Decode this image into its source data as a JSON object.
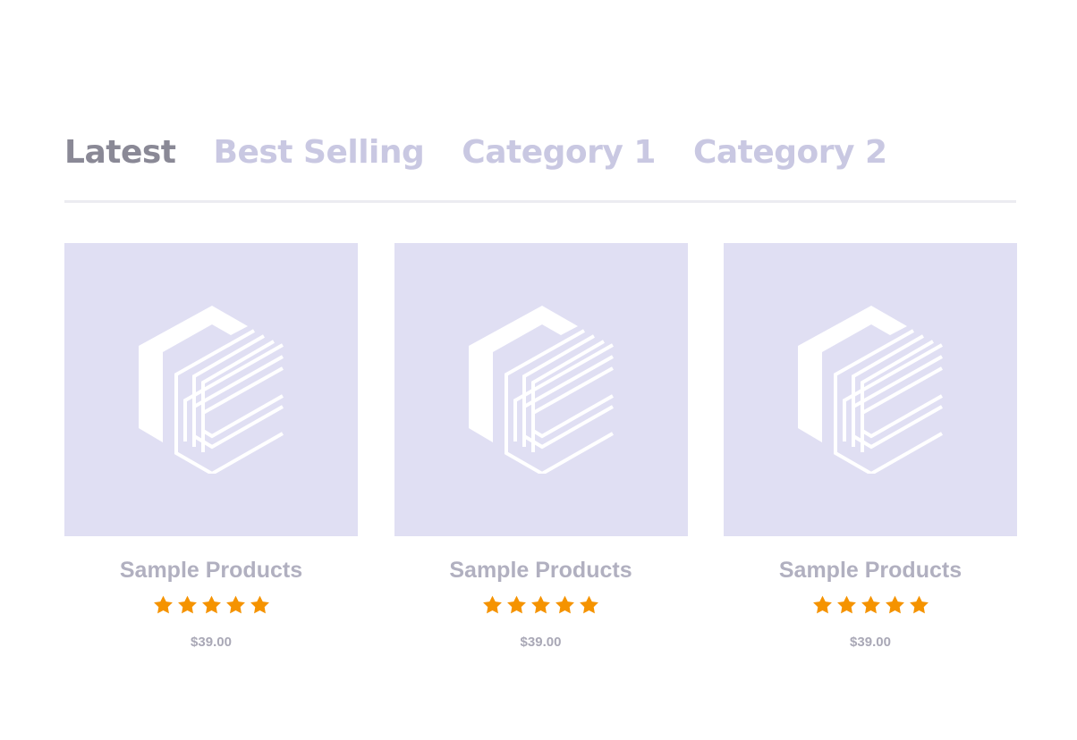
{
  "tabs": [
    {
      "label": "Latest",
      "active": true
    },
    {
      "label": "Best Selling",
      "active": false
    },
    {
      "label": "Category 1",
      "active": false
    },
    {
      "label": "Category 2",
      "active": false
    }
  ],
  "products": [
    {
      "name": "Sample Products",
      "rating": 5,
      "rating_max": 5,
      "price": "$39.00",
      "image_icon": "placeholder-logo-icon"
    },
    {
      "name": "Sample Products",
      "rating": 5,
      "rating_max": 5,
      "price": "$39.00",
      "image_icon": "placeholder-logo-icon"
    },
    {
      "name": "Sample Products",
      "rating": 5,
      "rating_max": 5,
      "price": "$39.00",
      "image_icon": "placeholder-logo-icon"
    }
  ],
  "colors": {
    "tab_active": "#8a8996",
    "tab_inactive": "#c9c8e2",
    "thumbnail_bg": "#e0dff3",
    "star": "#f59300",
    "product_name": "#b1b0c0",
    "price": "#a9a8b6",
    "divider": "#ececf1"
  }
}
